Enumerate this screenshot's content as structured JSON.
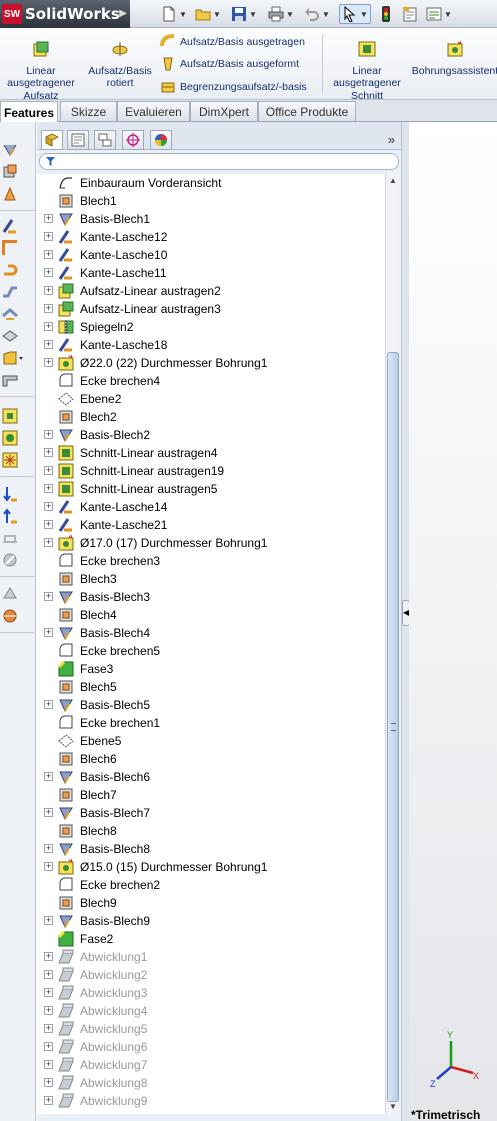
{
  "app": {
    "brand": "SolidWorks",
    "brand_mark": "SW"
  },
  "ribbon": {
    "linear_boss": "Linear ausgetragener Aufsatz",
    "revolved_boss": "Aufsatz/Basis rotiert",
    "extruded_boss": "Aufsatz/Basis ausgetragen",
    "lofted_boss": "Aufsatz/Basis ausgeformt",
    "boundary_boss": "Begrenzungsaufsatz/-basis",
    "linear_cut": "Linear ausgetragener Schnitt",
    "hole_wizard": "Bohrungsassistent"
  },
  "tabs": [
    {
      "label": "Features",
      "active": true
    },
    {
      "label": "Skizze"
    },
    {
      "label": "Evaluieren"
    },
    {
      "label": "DimXpert"
    },
    {
      "label": "Office Produkte"
    }
  ],
  "tree": [
    {
      "label": "Einbauraum Vorderansicht",
      "icon": "sketch-icon",
      "expand": false
    },
    {
      "label": "Blech1",
      "icon": "sheetmetal-icon",
      "expand": false
    },
    {
      "label": "Basis-Blech1",
      "icon": "base-flange-icon",
      "expand": true
    },
    {
      "label": "Kante-Lasche12",
      "icon": "edge-flange-icon",
      "expand": true
    },
    {
      "label": "Kante-Lasche10",
      "icon": "edge-flange-icon",
      "expand": true
    },
    {
      "label": "Kante-Lasche11",
      "icon": "edge-flange-icon",
      "expand": true
    },
    {
      "label": "Aufsatz-Linear austragen2",
      "icon": "extrude-boss-icon",
      "expand": true
    },
    {
      "label": "Aufsatz-Linear austragen3",
      "icon": "extrude-boss-icon",
      "expand": true
    },
    {
      "label": "Spiegeln2",
      "icon": "mirror-icon",
      "expand": true
    },
    {
      "label": "Kante-Lasche18",
      "icon": "edge-flange-icon",
      "expand": true
    },
    {
      "label": "Ø22.0 (22) Durchmesser Bohrung1",
      "icon": "hole-icon",
      "expand": true
    },
    {
      "label": "Ecke brechen4",
      "icon": "break-corner-icon",
      "expand": false
    },
    {
      "label": "Ebene2",
      "icon": "plane-icon",
      "expand": false
    },
    {
      "label": "Blech2",
      "icon": "sheetmetal-icon",
      "expand": false
    },
    {
      "label": "Basis-Blech2",
      "icon": "base-flange-icon",
      "expand": true
    },
    {
      "label": "Schnitt-Linear austragen4",
      "icon": "extrude-cut-icon",
      "expand": true
    },
    {
      "label": "Schnitt-Linear austragen19",
      "icon": "extrude-cut-icon",
      "expand": true
    },
    {
      "label": "Schnitt-Linear austragen5",
      "icon": "extrude-cut-icon",
      "expand": true
    },
    {
      "label": "Kante-Lasche14",
      "icon": "edge-flange-icon",
      "expand": true
    },
    {
      "label": "Kante-Lasche21",
      "icon": "edge-flange-icon",
      "expand": true
    },
    {
      "label": "Ø17.0 (17) Durchmesser Bohrung1",
      "icon": "hole-icon",
      "expand": true
    },
    {
      "label": "Ecke brechen3",
      "icon": "break-corner-icon",
      "expand": false
    },
    {
      "label": "Blech3",
      "icon": "sheetmetal-icon",
      "expand": false
    },
    {
      "label": "Basis-Blech3",
      "icon": "base-flange-icon",
      "expand": true
    },
    {
      "label": "Blech4",
      "icon": "sheetmetal-icon",
      "expand": false
    },
    {
      "label": "Basis-Blech4",
      "icon": "base-flange-icon",
      "expand": true
    },
    {
      "label": "Ecke brechen5",
      "icon": "break-corner-icon",
      "expand": false
    },
    {
      "label": "Fase3",
      "icon": "chamfer-icon",
      "expand": false
    },
    {
      "label": "Blech5",
      "icon": "sheetmetal-icon",
      "expand": false
    },
    {
      "label": "Basis-Blech5",
      "icon": "base-flange-icon",
      "expand": true
    },
    {
      "label": "Ecke brechen1",
      "icon": "break-corner-icon",
      "expand": false
    },
    {
      "label": "Ebene5",
      "icon": "plane-icon",
      "expand": false
    },
    {
      "label": "Blech6",
      "icon": "sheetmetal-icon",
      "expand": false
    },
    {
      "label": "Basis-Blech6",
      "icon": "base-flange-icon",
      "expand": true
    },
    {
      "label": "Blech7",
      "icon": "sheetmetal-icon",
      "expand": false
    },
    {
      "label": "Basis-Blech7",
      "icon": "base-flange-icon",
      "expand": true
    },
    {
      "label": "Blech8",
      "icon": "sheetmetal-icon",
      "expand": false
    },
    {
      "label": "Basis-Blech8",
      "icon": "base-flange-icon",
      "expand": true
    },
    {
      "label": "Ø15.0 (15) Durchmesser Bohrung1",
      "icon": "hole-icon",
      "expand": true
    },
    {
      "label": "Ecke brechen2",
      "icon": "break-corner-icon",
      "expand": false
    },
    {
      "label": "Blech9",
      "icon": "sheetmetal-icon",
      "expand": false
    },
    {
      "label": "Basis-Blech9",
      "icon": "base-flange-icon",
      "expand": true
    },
    {
      "label": "Fase2",
      "icon": "chamfer-icon",
      "expand": false
    },
    {
      "label": "Abwicklung1",
      "icon": "flat-pattern-icon",
      "expand": true,
      "suppressed": true
    },
    {
      "label": "Abwicklung2",
      "icon": "flat-pattern-icon",
      "expand": true,
      "suppressed": true
    },
    {
      "label": "Abwicklung3",
      "icon": "flat-pattern-icon",
      "expand": true,
      "suppressed": true
    },
    {
      "label": "Abwicklung4",
      "icon": "flat-pattern-icon",
      "expand": true,
      "suppressed": true
    },
    {
      "label": "Abwicklung5",
      "icon": "flat-pattern-icon",
      "expand": true,
      "suppressed": true
    },
    {
      "label": "Abwicklung6",
      "icon": "flat-pattern-icon",
      "expand": true,
      "suppressed": true
    },
    {
      "label": "Abwicklung7",
      "icon": "flat-pattern-icon",
      "expand": true,
      "suppressed": true
    },
    {
      "label": "Abwicklung8",
      "icon": "flat-pattern-icon",
      "expand": true,
      "suppressed": true
    },
    {
      "label": "Abwicklung9",
      "icon": "flat-pattern-icon",
      "expand": true,
      "suppressed": true
    }
  ],
  "viewport": {
    "view_label": "*Trimetrisch",
    "axis_x": "X",
    "axis_y": "Y",
    "axis_z": "Z"
  },
  "colors": {
    "accent": "#15306b",
    "suppressed_text": "#9a9a9a",
    "selection_blue": "#2b63c6"
  }
}
